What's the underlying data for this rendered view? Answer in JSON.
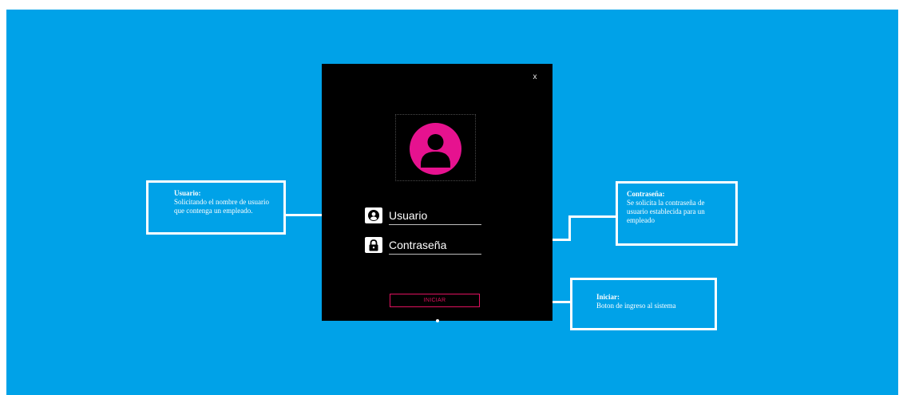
{
  "login": {
    "close_label": "x",
    "username_label": "Usuario",
    "password_label": "Contraseña",
    "submit_label": "INICIAR"
  },
  "annotations": {
    "usuario": {
      "title": "Usuario:",
      "text": "Solicitando el nombre de usuario que contenga un empleado."
    },
    "contrasena": {
      "title": "Contraseña:",
      "text": "Se solicita la contraseña de usuario establecida para un empleado"
    },
    "iniciar": {
      "title": "Iniciar:",
      "text": "Boton de ingreso al sistema"
    }
  },
  "colors": {
    "background": "#00a2e8",
    "window": "#000000",
    "accent": "#e6128f",
    "button_border": "#e0115f"
  },
  "icons": {
    "avatar": "user-avatar-icon",
    "username": "user-circle-icon",
    "password": "lock-icon",
    "close": "close-icon"
  }
}
